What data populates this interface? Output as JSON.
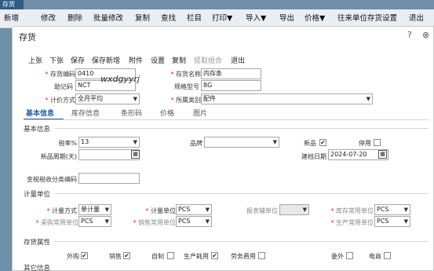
{
  "app_tab": "存货",
  "toolbar": [
    "新增",
    "修改",
    "删除",
    "批量修改",
    "复制",
    "查找",
    "栏目",
    "打印▼",
    "导入▼",
    "导出",
    "价格▼",
    "往来单位存货设置",
    "退出"
  ],
  "dialog": {
    "title": "存货",
    "help_icon": "?",
    "close_icon": "⊗",
    "actions": [
      "上张",
      "下张",
      "保存",
      "保存新增",
      "附件",
      "设置",
      "复制",
      "提取组合",
      "退出"
    ],
    "code_label": "存货编码",
    "code_value": "0410",
    "name_label": "存货名称",
    "name_value": "内存条",
    "mnemonic_label": "助记码",
    "mnemonic_value": "NCT",
    "handwriting": "wxdgyyrj",
    "spec_label": "规格型号",
    "spec_value": "8G",
    "pricing_label": "计价方式",
    "pricing_value": "全月平均",
    "category_label": "所属类别",
    "category_value": "配件",
    "tabs": [
      "基本信息",
      "库存信息",
      "条形码",
      "价格",
      "图片"
    ],
    "basic_section": "基本信息",
    "tax_label": "税率%",
    "tax_value": "13",
    "brand_label": "品牌",
    "brand_value": "",
    "new_label": "新品",
    "new_checked": true,
    "disabled_label": "停用",
    "disabled_checked": false,
    "new_period_label": "新品周期(天)",
    "new_period_value": "",
    "created_label": "建档日期",
    "created_value": "2024-07-20",
    "tax_class_label": "金税税收分类编码",
    "tax_class_value": "",
    "unit_section": "计量单位",
    "unit_method_label": "计量方式",
    "unit_method_value": "单计量",
    "unit_label": "计量单位",
    "unit_value": "PCS",
    "report_unit_label": "报表辅单位",
    "report_unit_value": "",
    "stock_unit_label": "库存常用单位",
    "stock_unit_value": "PCS",
    "purchase_unit_label": "采购常用单位",
    "purchase_unit_value": "PCS",
    "sales_unit_label": "销售常用单位",
    "sales_unit_value": "PCS",
    "prod_unit_label": "生产常用单位",
    "prod_unit_value": "PCS",
    "attr_section": "存货属性",
    "attrs": [
      {
        "label": "外购",
        "checked": true
      },
      {
        "label": "销售",
        "checked": true
      },
      {
        "label": "自制",
        "checked": false
      },
      {
        "label": "生产耗用",
        "checked": true
      },
      {
        "label": "劳务费用",
        "checked": false
      },
      {
        "label": "委外",
        "checked": false
      },
      {
        "label": "电商",
        "checked": false
      }
    ],
    "other_section": "其它信息"
  }
}
